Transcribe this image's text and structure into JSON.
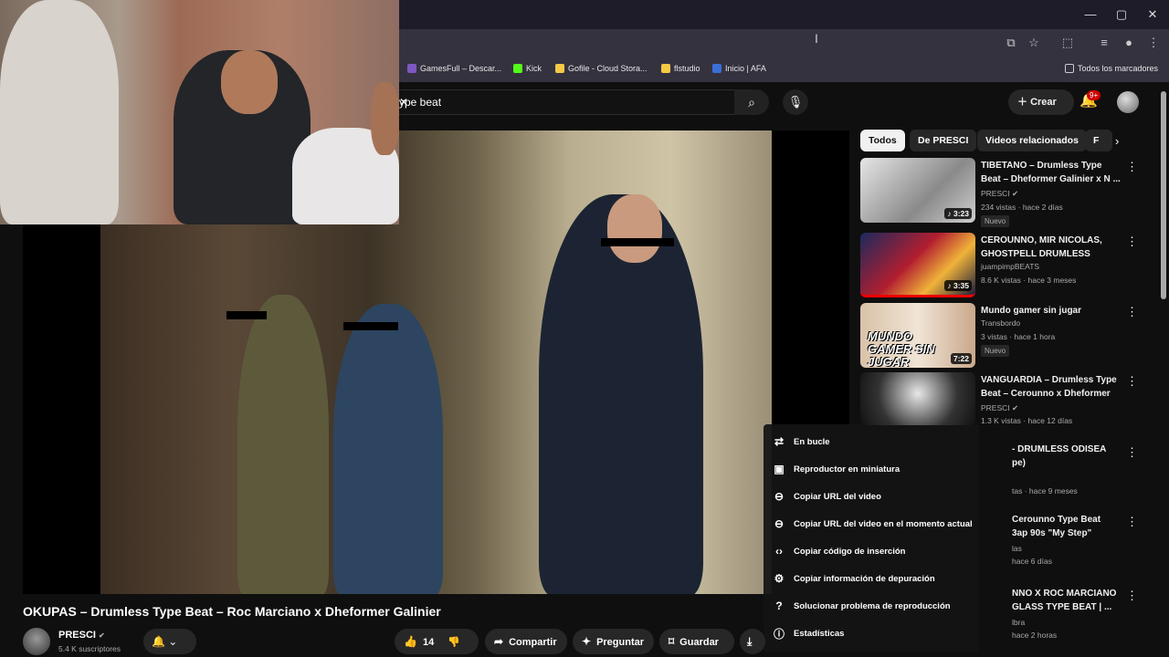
{
  "browser": {
    "window_controls": [
      "—",
      "▢",
      "✕"
    ],
    "bookmarks": [
      {
        "label": "GamesFull – Descar...",
        "color": "#7e57c2"
      },
      {
        "label": "Kick",
        "color": "#53fc18"
      },
      {
        "label": "Gofile - Cloud Stora...",
        "color": "#f6c945"
      },
      {
        "label": "flstudio",
        "color": "#f6c945"
      },
      {
        "label": "Inicio | AFA",
        "color": "#3b6fd6"
      }
    ],
    "all_bookmarks": "Todos los marcadores"
  },
  "header": {
    "search_value": "ype beat",
    "create_label": "Crear",
    "notif_badge": "9+"
  },
  "video": {
    "title": "OKUPAS – Drumless Type Beat – Roc Marciano x Dheformer Galinier",
    "channel": "PRESCI",
    "subscribers": "5.4 K suscriptores",
    "likes": "14",
    "share": "Compartir",
    "ask": "Preguntar",
    "save": "Guardar"
  },
  "context_menu": [
    {
      "label": "En bucle",
      "icon": "loop-icon"
    },
    {
      "label": "Reproductor en miniatura",
      "icon": "miniplayer-icon"
    },
    {
      "label": "Copiar URL del video",
      "icon": "link-icon"
    },
    {
      "label": "Copiar URL del video en el momento actual",
      "icon": "link-time-icon"
    },
    {
      "label": "Copiar código de inserción",
      "icon": "embed-icon"
    },
    {
      "label": "Copiar información de depuración",
      "icon": "debug-icon"
    },
    {
      "label": "Solucionar problema de reproducción",
      "icon": "troubleshoot-icon"
    },
    {
      "label": "Estadísticas",
      "icon": "info-icon"
    }
  ],
  "chips": [
    "Todos",
    "De PRESCI",
    "Videos relacionados",
    "F"
  ],
  "recommendations": [
    {
      "title": "TIBETANO – Drumless Type Beat – Dheformer Galinier x N ...",
      "channel": "PRESCI",
      "meta": "234 vistas · hace 2 días",
      "badge": "Nuevo",
      "duration": "3:23"
    },
    {
      "title": "CEROUNNO, MIR NICOLAS, GHOSTPELL DRUMLESS TYPE...",
      "channel": "juampimpBEATS",
      "meta": "8.6 K vistas · hace 3 meses",
      "badge": "",
      "duration": "3:35"
    },
    {
      "title": "Mundo gamer sin jugar",
      "channel": "Transbordo",
      "meta": "3 vistas · hace 1 hora",
      "badge": "Nuevo",
      "duration": "7:22"
    },
    {
      "title": "VANGUARDIA – Drumless Type Beat – Cerounno x Dheformer",
      "channel": "PRESCI",
      "meta": "1.3 K vistas · hace 12 días",
      "badge": "",
      "duration": ""
    }
  ],
  "partial_recs": [
    {
      "title1": "- DRUMLESS ODISEA",
      "title2": "pe)",
      "meta1": "tas · hace 9 meses",
      "meta2": ""
    },
    {
      "title1": "Cerounno Type Beat",
      "title2": "3ap 90s \"My Step\"",
      "meta1": "las",
      "meta2": "hace 6 días"
    },
    {
      "title1": "NNO X ROC MARCIANO",
      "title2": "GLASS TYPE BEAT | ...",
      "meta1": "lbra",
      "meta2": "hace 2 horas"
    }
  ],
  "thumb_text": "MUNDO GAMER SIN JUGAR"
}
